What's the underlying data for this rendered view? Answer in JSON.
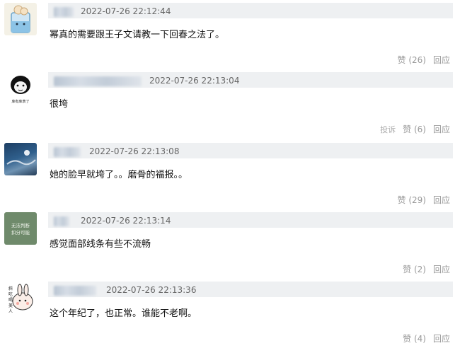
{
  "comments": [
    {
      "time": "2022-07-26 22:12:44",
      "text": "幂真的需要跟王子文请教一下回春之法了。",
      "like": "赞 (26)",
      "reply": "回应",
      "report": ""
    },
    {
      "time": "2022-07-26 22:13:04",
      "text": "很垮",
      "like": "赞 (6)",
      "reply": "回应",
      "report": "投诉"
    },
    {
      "time": "2022-07-26 22:13:08",
      "text": "她的脸早就垮了。。磨骨的福报。。",
      "like": "赞 (29)",
      "reply": "回应",
      "report": ""
    },
    {
      "time": "2022-07-26 22:13:14",
      "text": "感觉面部线条有些不流畅",
      "like": "赞 (2)",
      "reply": "回应",
      "report": ""
    },
    {
      "time": "2022-07-26 22:13:36",
      "text": "这个年纪了，也正常。谁能不老啊。",
      "like": "赞 (4)",
      "reply": "回应",
      "report": ""
    }
  ],
  "avatar_text": {
    "a2": "库有库表了",
    "a4": [
      "无法判断",
      "扣分可能"
    ],
    "a5": [
      "斜",
      "吃",
      "喝",
      "美",
      "人"
    ]
  },
  "colors": {
    "meta_bg": "#eef0f2",
    "muted": "#999999",
    "timestamp": "#666666"
  }
}
